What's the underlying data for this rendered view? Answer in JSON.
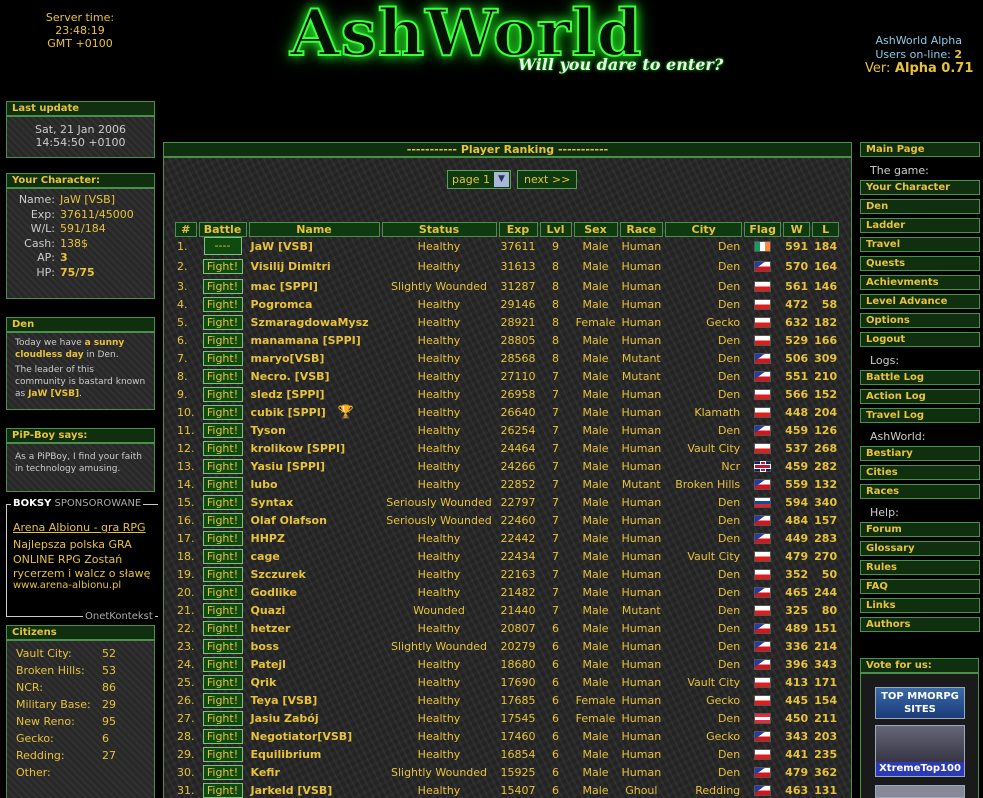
{
  "header": {
    "server_time_label": "Server time:",
    "server_time": "23:48:19",
    "server_tz": "GMT +0100",
    "logo_title": "AshWorld",
    "logo_tagline": "Will you dare to enter?",
    "app_name": "AshWorld Alpha",
    "users_online_label": "Users on-line:",
    "users_online": "2",
    "version_label": "Ver:",
    "version": "Alpha 0.71"
  },
  "last_update": {
    "title": "Last update",
    "date": "Sat, 21 Jan 2006",
    "time": "14:54:50 +0100"
  },
  "character": {
    "title": "Your Character:",
    "rows": [
      {
        "k": "Name:",
        "v": "JaW [VSB]"
      },
      {
        "k": "Exp:",
        "v": "37611/45000"
      },
      {
        "k": "W/L:",
        "v": "591/184"
      },
      {
        "k": "Cash:",
        "v": "138$"
      },
      {
        "k": "AP:",
        "v": "3"
      },
      {
        "k": "HP:",
        "v": "75/75"
      }
    ]
  },
  "location": {
    "title": "Den",
    "p1_a": "Today we have ",
    "p1_b": "a sunny cloudless day",
    "p1_c": " in Den.",
    "p2_a": "The leader of this community is bastard known as ",
    "p2_b": "JaW [VSB]",
    "p2_c": "."
  },
  "pipboy": {
    "title": "PiP-Boy says:",
    "text": "As a PiPBoy, I find your faith in technology amusing."
  },
  "sponsor": {
    "head_bold": "BOKSY",
    "head_rest": " SPONSOROWANE",
    "link": "Arena Albionu - gra RPG",
    "text": "Najlepsza polska GRA ONLINE RPG Zostań rycerzem i walcz o sławę",
    "url": "www.arena-albionu.pl",
    "footer": "OnetKontekst"
  },
  "citizens": {
    "title": "Citizens",
    "rows": [
      {
        "k": "Vault City:",
        "v": "52"
      },
      {
        "k": "Broken Hills:",
        "v": "53"
      },
      {
        "k": "NCR:",
        "v": "86"
      },
      {
        "k": "Military Base:",
        "v": "29"
      },
      {
        "k": "New Reno:",
        "v": "95"
      },
      {
        "k": "Gecko:",
        "v": "6"
      },
      {
        "k": "Redding:",
        "v": "27"
      },
      {
        "k": "Other:",
        "v": ""
      }
    ]
  },
  "ranking": {
    "title": "----------- Player Ranking -----------",
    "page_select": "page 1",
    "next": "next >>",
    "columns": [
      "#",
      "Battle",
      "Name",
      "Status",
      "Exp",
      "Lvl",
      "Sex",
      "Race",
      "City",
      "Flag",
      "W",
      "L"
    ],
    "fight_label": "Fight!",
    "self_label": "----",
    "rows": [
      {
        "no": "1.",
        "self": true,
        "name": "JaW [VSB]",
        "status": "Healthy",
        "exp": "37611",
        "lvl": "9",
        "sex": "Male",
        "race": "Human",
        "city": "Den",
        "flag": "ie",
        "w": "591",
        "l": "184"
      },
      {
        "no": "2.",
        "name": "Visilij Dimitri",
        "status": "Healthy",
        "exp": "31613",
        "lvl": "8",
        "sex": "Male",
        "race": "Human",
        "city": "Den",
        "flag": "cz",
        "w": "570",
        "l": "164"
      },
      {
        "no": "3.",
        "name": "mac [SPPI]",
        "status": "Slightly Wounded",
        "exp": "31287",
        "lvl": "8",
        "sex": "Male",
        "race": "Human",
        "city": "Den",
        "flag": "pl",
        "w": "561",
        "l": "146"
      },
      {
        "no": "4.",
        "name": "Pogromca",
        "status": "Healthy",
        "exp": "29146",
        "lvl": "8",
        "sex": "Male",
        "race": "Human",
        "city": "Den",
        "flag": "pl",
        "w": "472",
        "l": "58"
      },
      {
        "no": "5.",
        "name": "SzmaragdowaMysz",
        "status": "Healthy",
        "exp": "28921",
        "lvl": "8",
        "sex": "Female",
        "race": "Human",
        "city": "Gecko",
        "flag": "pl",
        "w": "632",
        "l": "182"
      },
      {
        "no": "6.",
        "name": "manamana [SPPI]",
        "status": "Healthy",
        "exp": "28805",
        "lvl": "8",
        "sex": "Male",
        "race": "Human",
        "city": "Den",
        "flag": "pl",
        "w": "529",
        "l": "166"
      },
      {
        "no": "7.",
        "name": "maryo[VSB]",
        "status": "Healthy",
        "exp": "28568",
        "lvl": "8",
        "sex": "Male",
        "race": "Mutant",
        "city": "Den",
        "flag": "cz",
        "w": "506",
        "l": "309"
      },
      {
        "no": "8.",
        "name": "Necro. [VSB]",
        "status": "Healthy",
        "exp": "27110",
        "lvl": "7",
        "sex": "Male",
        "race": "Mutant",
        "city": "Den",
        "flag": "cz",
        "w": "551",
        "l": "210"
      },
      {
        "no": "9.",
        "name": "sledz [SPPI]",
        "status": "Healthy",
        "exp": "26958",
        "lvl": "7",
        "sex": "Male",
        "race": "Human",
        "city": "Den",
        "flag": "pl",
        "w": "566",
        "l": "152"
      },
      {
        "no": "10.",
        "name": "cubik [SPPI]",
        "trophy": true,
        "status": "Healthy",
        "exp": "26640",
        "lvl": "7",
        "sex": "Male",
        "race": "Human",
        "city": "Klamath",
        "flag": "pl",
        "w": "448",
        "l": "204"
      },
      {
        "no": "11.",
        "name": "Tyson",
        "status": "Healthy",
        "exp": "26254",
        "lvl": "7",
        "sex": "Male",
        "race": "Human",
        "city": "Den",
        "flag": "cz",
        "w": "459",
        "l": "126"
      },
      {
        "no": "12.",
        "name": "krolikow [SPPI]",
        "status": "Healthy",
        "exp": "24464",
        "lvl": "7",
        "sex": "Male",
        "race": "Human",
        "city": "Vault City",
        "flag": "pl",
        "w": "537",
        "l": "268"
      },
      {
        "no": "13.",
        "name": "Yasiu [SPPI]",
        "status": "Healthy",
        "exp": "24266",
        "lvl": "7",
        "sex": "Male",
        "race": "Human",
        "city": "Ncr",
        "flag": "uk",
        "w": "459",
        "l": "282"
      },
      {
        "no": "14.",
        "name": "lubo",
        "status": "Healthy",
        "exp": "22852",
        "lvl": "7",
        "sex": "Male",
        "race": "Mutant",
        "city": "Broken Hills",
        "flag": "cz",
        "w": "559",
        "l": "132"
      },
      {
        "no": "15.",
        "name": "Syntax",
        "status": "Seriously Wounded",
        "exp": "22797",
        "lvl": "7",
        "sex": "Male",
        "race": "Human",
        "city": "Den",
        "flag": "sk",
        "w": "594",
        "l": "340"
      },
      {
        "no": "16.",
        "name": "Olaf Olafson",
        "status": "Seriously Wounded",
        "exp": "22460",
        "lvl": "7",
        "sex": "Male",
        "race": "Human",
        "city": "Den",
        "flag": "cz",
        "w": "484",
        "l": "157"
      },
      {
        "no": "17.",
        "name": "HHPZ",
        "status": "Healthy",
        "exp": "22442",
        "lvl": "7",
        "sex": "Male",
        "race": "Human",
        "city": "Den",
        "flag": "cz",
        "w": "449",
        "l": "283"
      },
      {
        "no": "18.",
        "name": "cage",
        "status": "Healthy",
        "exp": "22434",
        "lvl": "7",
        "sex": "Male",
        "race": "Human",
        "city": "Vault City",
        "flag": "pl",
        "w": "479",
        "l": "270"
      },
      {
        "no": "19.",
        "name": "Szczurek",
        "status": "Healthy",
        "exp": "22163",
        "lvl": "7",
        "sex": "Male",
        "race": "Human",
        "city": "Den",
        "flag": "pl",
        "w": "352",
        "l": "50"
      },
      {
        "no": "20.",
        "name": "Godlike",
        "status": "Healthy",
        "exp": "21482",
        "lvl": "7",
        "sex": "Male",
        "race": "Human",
        "city": "Den",
        "flag": "cz",
        "w": "465",
        "l": "244"
      },
      {
        "no": "21.",
        "name": "Quazi",
        "status": "Wounded",
        "exp": "21440",
        "lvl": "7",
        "sex": "Male",
        "race": "Mutant",
        "city": "Den",
        "flag": "pl",
        "w": "325",
        "l": "80"
      },
      {
        "no": "22.",
        "name": "hetzer",
        "status": "Healthy",
        "exp": "20807",
        "lvl": "6",
        "sex": "Male",
        "race": "Human",
        "city": "Den",
        "flag": "cz",
        "w": "489",
        "l": "151"
      },
      {
        "no": "23.",
        "name": "boss",
        "status": "Slightly Wounded",
        "exp": "20279",
        "lvl": "6",
        "sex": "Male",
        "race": "Human",
        "city": "Den",
        "flag": "cz",
        "w": "336",
        "l": "214"
      },
      {
        "no": "24.",
        "name": "Patejl",
        "status": "Healthy",
        "exp": "18680",
        "lvl": "6",
        "sex": "Male",
        "race": "Human",
        "city": "Den",
        "flag": "cz",
        "w": "396",
        "l": "343"
      },
      {
        "no": "25.",
        "name": "Qrik",
        "status": "Healthy",
        "exp": "17690",
        "lvl": "6",
        "sex": "Male",
        "race": "Human",
        "city": "Vault City",
        "flag": "pl",
        "w": "413",
        "l": "171"
      },
      {
        "no": "26.",
        "name": "Teya [VSB]",
        "status": "Healthy",
        "exp": "17685",
        "lvl": "6",
        "sex": "Female",
        "race": "Human",
        "city": "Gecko",
        "flag": "pl",
        "w": "445",
        "l": "154"
      },
      {
        "no": "27.",
        "name": "Jasiu Zabój",
        "status": "Healthy",
        "exp": "17545",
        "lvl": "6",
        "sex": "Female",
        "race": "Human",
        "city": "Den",
        "flag": "at",
        "w": "450",
        "l": "211"
      },
      {
        "no": "28.",
        "name": "Negotiator[VSB]",
        "status": "Healthy",
        "exp": "17460",
        "lvl": "6",
        "sex": "Male",
        "race": "Human",
        "city": "Gecko",
        "flag": "cz",
        "w": "343",
        "l": "203"
      },
      {
        "no": "29.",
        "name": "Equilibrium",
        "status": "Healthy",
        "exp": "16854",
        "lvl": "6",
        "sex": "Male",
        "race": "Human",
        "city": "Den",
        "flag": "pl",
        "w": "441",
        "l": "235"
      },
      {
        "no": "30.",
        "name": "Kefir",
        "status": "Slightly Wounded",
        "exp": "15925",
        "lvl": "6",
        "sex": "Male",
        "race": "Human",
        "city": "Den",
        "flag": "cz",
        "w": "479",
        "l": "362"
      },
      {
        "no": "31.",
        "name": "Jarkeld [VSB]",
        "status": "Healthy",
        "exp": "15407",
        "lvl": "6",
        "sex": "Male",
        "race": "Ghoul",
        "city": "Redding",
        "flag": "cz",
        "w": "463",
        "l": "131"
      }
    ]
  },
  "nav": {
    "items": [
      {
        "type": "link",
        "label": "Main Page"
      },
      {
        "type": "label",
        "label": "The game:"
      },
      {
        "type": "link",
        "label": "Your Character"
      },
      {
        "type": "link",
        "label": "Den"
      },
      {
        "type": "link",
        "label": "Ladder"
      },
      {
        "type": "link",
        "label": "Travel"
      },
      {
        "type": "link",
        "label": "Quests"
      },
      {
        "type": "link",
        "label": "Achievments"
      },
      {
        "type": "link",
        "label": "Level Advance"
      },
      {
        "type": "link",
        "label": "Options"
      },
      {
        "type": "link",
        "label": "Logout"
      },
      {
        "type": "label",
        "label": "Logs:"
      },
      {
        "type": "link",
        "label": "Battle Log"
      },
      {
        "type": "link",
        "label": "Action Log"
      },
      {
        "type": "link",
        "label": "Travel Log"
      },
      {
        "type": "label",
        "label": "AshWorld:"
      },
      {
        "type": "link",
        "label": "Bestiary"
      },
      {
        "type": "link",
        "label": "Cities"
      },
      {
        "type": "link",
        "label": "Races"
      },
      {
        "type": "label",
        "label": "Help:"
      },
      {
        "type": "link",
        "label": "Forum"
      },
      {
        "type": "link",
        "label": "Glossary"
      },
      {
        "type": "link",
        "label": "Rules"
      },
      {
        "type": "link",
        "label": "FAQ"
      },
      {
        "type": "link",
        "label": "Links"
      },
      {
        "type": "link",
        "label": "Authors"
      }
    ]
  },
  "vote": {
    "title": "Vote for us:",
    "b1": "TOP MMORPG SITES",
    "b2": "XtremeTop100"
  }
}
